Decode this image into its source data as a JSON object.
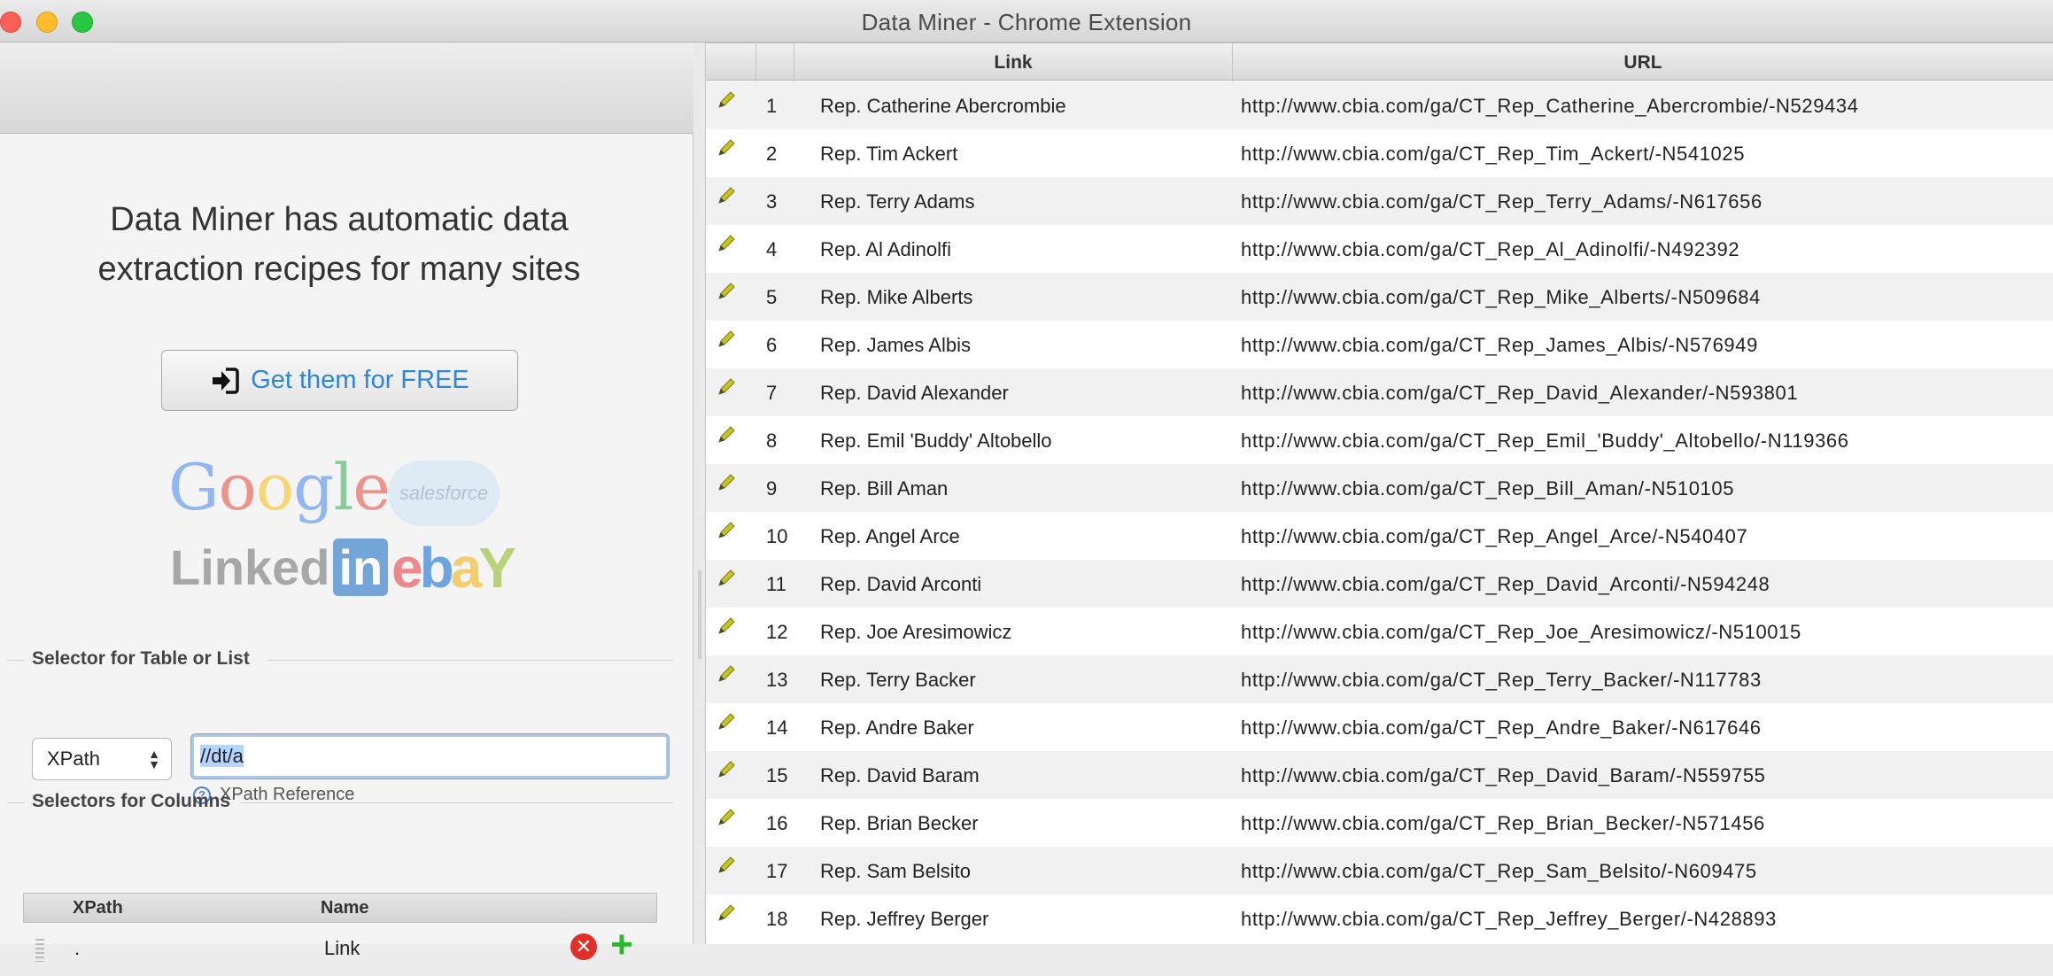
{
  "window": {
    "title": "Data Miner - Chrome Extension"
  },
  "promo": {
    "line1": "Data Miner has automatic data",
    "line2": "extraction recipes for many sites",
    "button_label": "Get them for FREE",
    "logos": {
      "google": [
        "G",
        "o",
        "o",
        "g",
        "l",
        "e"
      ],
      "salesforce": "salesforce",
      "linkedin_text": "Linked",
      "linkedin_in": "in",
      "ebay": [
        "e",
        "b",
        "a",
        "Y"
      ]
    }
  },
  "selector_table": {
    "section_label": "Selector for Table or List",
    "type_value": "XPath",
    "xpath_value": "//dt/a",
    "reference_link": "XPath Reference"
  },
  "selector_columns": {
    "section_label": "Selectors for Columns",
    "headers": [
      "XPath",
      "Name"
    ],
    "rows": [
      {
        "xpath": ".",
        "name": "Link"
      }
    ]
  },
  "results": {
    "headers": [
      "",
      "",
      "Link",
      "URL"
    ],
    "rows": [
      {
        "n": "1",
        "link": "Rep. Catherine Abercrombie",
        "url": "http://www.cbia.com/ga/CT_Rep_Catherine_Abercrombie/-N529434"
      },
      {
        "n": "2",
        "link": "Rep. Tim Ackert",
        "url": "http://www.cbia.com/ga/CT_Rep_Tim_Ackert/-N541025"
      },
      {
        "n": "3",
        "link": "Rep. Terry Adams",
        "url": "http://www.cbia.com/ga/CT_Rep_Terry_Adams/-N617656"
      },
      {
        "n": "4",
        "link": "Rep. Al Adinolfi",
        "url": "http://www.cbia.com/ga/CT_Rep_Al_Adinolfi/-N492392"
      },
      {
        "n": "5",
        "link": "Rep. Mike Alberts",
        "url": "http://www.cbia.com/ga/CT_Rep_Mike_Alberts/-N509684"
      },
      {
        "n": "6",
        "link": "Rep. James Albis",
        "url": "http://www.cbia.com/ga/CT_Rep_James_Albis/-N576949"
      },
      {
        "n": "7",
        "link": "Rep. David Alexander",
        "url": "http://www.cbia.com/ga/CT_Rep_David_Alexander/-N593801"
      },
      {
        "n": "8",
        "link": "Rep. Emil 'Buddy' Altobello",
        "url": "http://www.cbia.com/ga/CT_Rep_Emil_'Buddy'_Altobello/-N119366"
      },
      {
        "n": "9",
        "link": "Rep. Bill Aman",
        "url": "http://www.cbia.com/ga/CT_Rep_Bill_Aman/-N510105"
      },
      {
        "n": "10",
        "link": "Rep. Angel Arce",
        "url": "http://www.cbia.com/ga/CT_Rep_Angel_Arce/-N540407"
      },
      {
        "n": "11",
        "link": "Rep. David Arconti",
        "url": "http://www.cbia.com/ga/CT_Rep_David_Arconti/-N594248"
      },
      {
        "n": "12",
        "link": "Rep. Joe Aresimowicz",
        "url": "http://www.cbia.com/ga/CT_Rep_Joe_Aresimowicz/-N510015"
      },
      {
        "n": "13",
        "link": "Rep. Terry Backer",
        "url": "http://www.cbia.com/ga/CT_Rep_Terry_Backer/-N117783"
      },
      {
        "n": "14",
        "link": "Rep. Andre Baker",
        "url": "http://www.cbia.com/ga/CT_Rep_Andre_Baker/-N617646"
      },
      {
        "n": "15",
        "link": "Rep. David Baram",
        "url": "http://www.cbia.com/ga/CT_Rep_David_Baram/-N559755"
      },
      {
        "n": "16",
        "link": "Rep. Brian Becker",
        "url": "http://www.cbia.com/ga/CT_Rep_Brian_Becker/-N571456"
      },
      {
        "n": "17",
        "link": "Rep. Sam Belsito",
        "url": "http://www.cbia.com/ga/CT_Rep_Sam_Belsito/-N609475"
      },
      {
        "n": "18",
        "link": "Rep. Jeffrey Berger",
        "url": "http://www.cbia.com/ga/CT_Rep_Jeffrey_Berger/-N428893"
      }
    ]
  },
  "colors": {
    "accent_link": "#2f86d8",
    "close": "#fc5f57",
    "minimize": "#fdbc2e",
    "maximize": "#28c840",
    "delete": "#e0302a",
    "add": "#2db52f"
  },
  "icons": {
    "edit": "pencil-icon",
    "signin": "sign-in-icon",
    "help": "question-circle-icon",
    "delete": "delete-icon",
    "add": "plus-icon",
    "select_arrows": "select-arrows-icon"
  }
}
